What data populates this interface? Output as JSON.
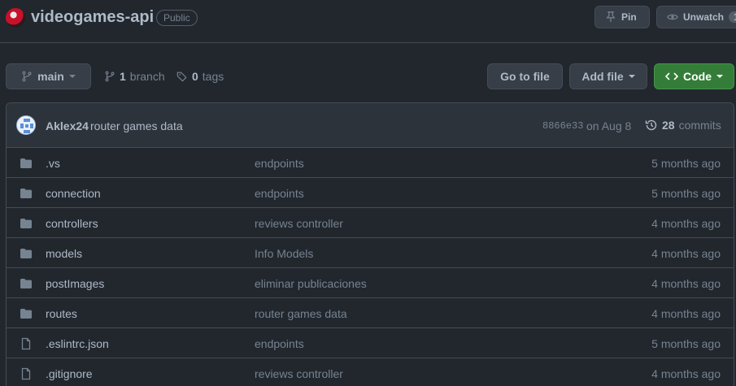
{
  "repo": {
    "name": "videogames-api",
    "visibility": "Public",
    "pin_label": "Pin",
    "watch_label": "Unwatch",
    "watch_count": "1"
  },
  "toolbar": {
    "branch": "main",
    "branches_count": "1",
    "branches_label": "branch",
    "tags_count": "0",
    "tags_label": "tags",
    "go_to_file": "Go to file",
    "add_file": "Add file",
    "code": "Code"
  },
  "commit": {
    "author": "Aklex24",
    "message": "router games data",
    "sha": "8866e33",
    "date": "on Aug 8",
    "count": "28",
    "count_label": "commits"
  },
  "files": [
    {
      "type": "folder",
      "name": ".vs",
      "message": "endpoints",
      "age": "5 months ago"
    },
    {
      "type": "folder",
      "name": "connection",
      "message": "endpoints",
      "age": "5 months ago"
    },
    {
      "type": "folder",
      "name": "controllers",
      "message": "reviews controller",
      "age": "4 months ago"
    },
    {
      "type": "folder",
      "name": "models",
      "message": "Info Models",
      "age": "4 months ago"
    },
    {
      "type": "folder",
      "name": "postImages",
      "message": "eliminar publicaciones",
      "age": "4 months ago"
    },
    {
      "type": "folder",
      "name": "routes",
      "message": "router games data",
      "age": "4 months ago"
    },
    {
      "type": "file",
      "name": ".eslintrc.json",
      "message": "endpoints",
      "age": "5 months ago"
    },
    {
      "type": "file",
      "name": ".gitignore",
      "message": "reviews controller",
      "age": "4 months ago"
    }
  ],
  "colors": {
    "background": "#22272e",
    "code_button": "#347d39",
    "folder_icon": "#768390"
  }
}
